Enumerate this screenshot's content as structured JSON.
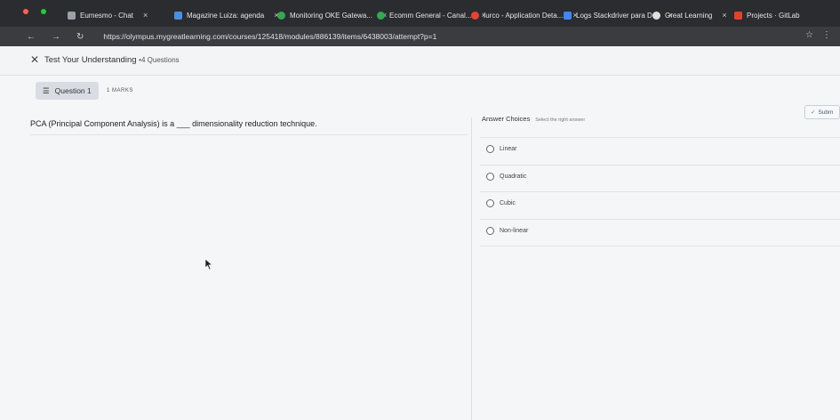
{
  "browser": {
    "tabs": [
      {
        "label": "Eumesmo - Chat",
        "color": "#9aa0a6"
      },
      {
        "label": "Magazine Luiza: agenda",
        "color": "#4a90e2"
      },
      {
        "label": "Monitoring OKE Gatewa...",
        "color": "#34a853"
      },
      {
        "label": "Ecomm General - Canal...",
        "color": "#34a853"
      },
      {
        "label": "Iurco - Application Deta...",
        "color": "#e94235"
      },
      {
        "label": "Logs Stackdriver para D...",
        "color": "#4285f4"
      },
      {
        "label": "Great Learning",
        "color": "#e0e0e0"
      },
      {
        "label": "Projects · GitLab",
        "color": "#e24329"
      }
    ],
    "url": "https://olympus.mygreatlearning.com/courses/125418/modules/886139/items/6438003/attempt?p=1",
    "url_host": "olympus.mygreatlearning.com"
  },
  "page": {
    "title": "Test Your Understanding",
    "question_count": "4 Questions",
    "question_label": "Question 1",
    "marks": "1 MARKS",
    "submit_label": "Subm",
    "question_text": "PCA (Principal Component Analysis) is a ___ dimensionality reduction technique.",
    "answers_heading": "Answer Choices",
    "answers_hint": "Select the right answer",
    "options": [
      "Linear",
      "Quadratic",
      "Cubic",
      "Non-linear"
    ]
  }
}
